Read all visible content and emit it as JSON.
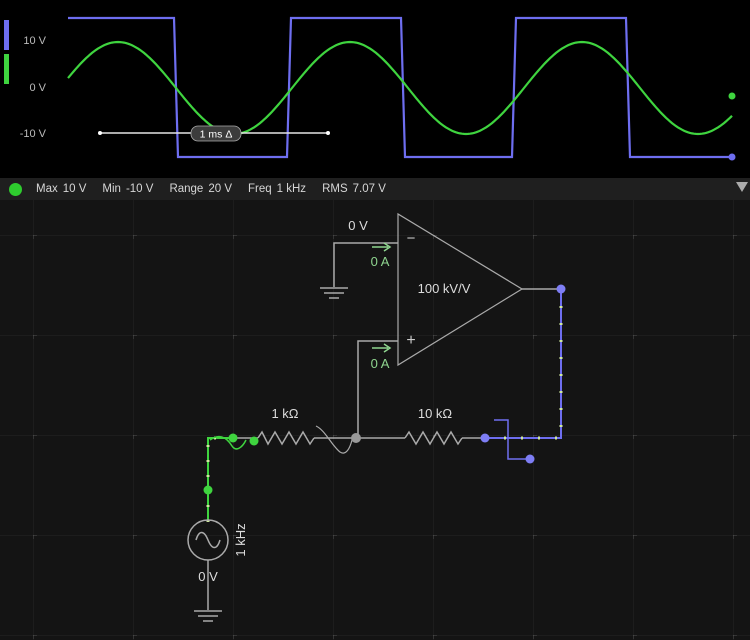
{
  "scope": {
    "y_tick_labels": [
      "10 V",
      "0 V",
      "-10 V"
    ],
    "time_cursor_label": "1 ms Δ",
    "channel_colors": {
      "square": "#6e6ef0",
      "sine": "#3fd43f"
    },
    "channel_chips": [
      "square-wave-channel",
      "sine-wave-channel"
    ]
  },
  "statusbar": {
    "indicator_color": "#2ecc2e",
    "max_label": "Max",
    "max_value": "10 V",
    "min_label": "Min",
    "min_value": "-10 V",
    "range_label": "Range",
    "range_value": "20 V",
    "freq_label": "Freq",
    "freq_value": "1 kHz",
    "rms_label": "RMS",
    "rms_value": "7.07 V"
  },
  "circuit": {
    "opamp_gain": "100 kV/V",
    "inverting_voltage": "0 V",
    "inverting_current": "0 A",
    "noninverting_current": "0 A",
    "inverting_symbol": "−",
    "noninverting_symbol": "+",
    "input_resistor": "1 kΩ",
    "feedback_resistor": "10 kΩ",
    "source_frequency": "1 kHz",
    "source_ground_voltage": "0 V"
  }
}
